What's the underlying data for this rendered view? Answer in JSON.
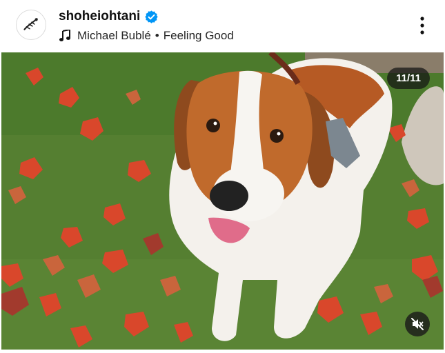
{
  "post": {
    "username": "shoheiohtani",
    "verified_icon": "verified-badge-icon",
    "audio": {
      "icon": "music-note-icon",
      "artist": "Michael Bublé",
      "separator": "•",
      "track": "Feeling Good"
    },
    "more_icon": "more-vertical-icon"
  },
  "media": {
    "counter": "11/11",
    "mute_icon": "speaker-muted-icon",
    "image_subject": "photo"
  },
  "colors": {
    "verified": "#0095f6",
    "counter_bg": "#141414",
    "grass": "#4f7a2d",
    "leaf": "#d9472b"
  }
}
